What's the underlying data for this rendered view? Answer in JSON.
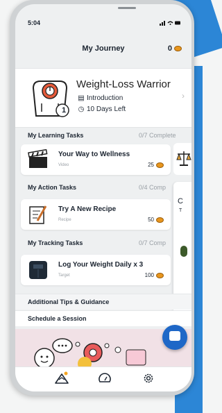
{
  "status": {
    "time": "5:04",
    "signal": "..ıl ᯤ ▬"
  },
  "header": {
    "title": "My Journey",
    "points": "0"
  },
  "journey": {
    "title": "Weight-Loss Warrior",
    "step_label": "Introduction",
    "days_left": "10 Days Left",
    "step_number": "1"
  },
  "sections": {
    "learning": {
      "label": "My Learning Tasks",
      "count": "0/7 Complete"
    },
    "action": {
      "label": "My Action Tasks",
      "count": "0/4 Comp"
    },
    "tracking": {
      "label": "My Tracking Tasks",
      "count": "0/7 Comp"
    }
  },
  "tasks": {
    "learning": {
      "name": "Your Way to Wellness",
      "type": "Video",
      "points": "25",
      "icon": "clapperboard-icon"
    },
    "action": {
      "name": "Try A New Recipe",
      "type": "Recipe",
      "points": "50",
      "icon": "recipe-icon"
    },
    "tracking": {
      "name": "Log Your Weight Daily x 3",
      "type": "Target",
      "points": "100",
      "icon": "scale-icon"
    }
  },
  "peek": {
    "letter": "C",
    "letter2": "T"
  },
  "more": {
    "tips_label": "Additional Tips & Guidance",
    "session_label": "Schedule a Session"
  },
  "tabbar": {
    "items": [
      {
        "name": "journey",
        "icon": "mountain-icon"
      },
      {
        "name": "dashboard",
        "icon": "gauge-icon"
      },
      {
        "name": "settings",
        "icon": "gear-icon"
      }
    ]
  },
  "colors": {
    "accent": "#1e67c7",
    "coin": "#e8961e",
    "bg_brand": "#2c86d6"
  }
}
